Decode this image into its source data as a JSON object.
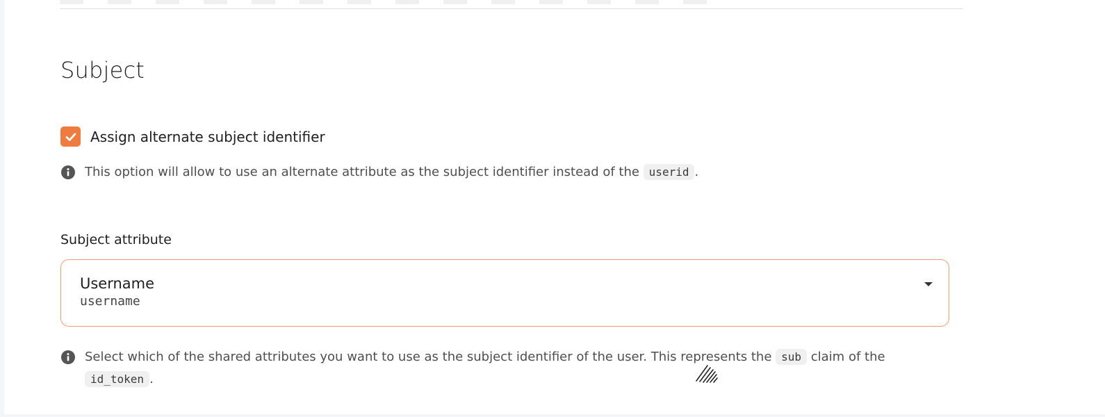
{
  "section": {
    "title": "Subject"
  },
  "alt_subject": {
    "checkbox_checked": true,
    "label": "Assign alternate subject identifier",
    "hint_prefix": "This option will allow to use an alternate attribute as the subject identifier instead of the ",
    "hint_code": "userid",
    "hint_suffix": "."
  },
  "subject_attribute": {
    "label": "Subject attribute",
    "selected_name": "Username",
    "selected_key": "username",
    "hint_prefix": "Select which of the shared attributes you want to use as the subject identifier of the user. This represents the ",
    "hint_code1": "sub",
    "hint_mid": " claim of the ",
    "hint_code2": "id_token",
    "hint_suffix": "."
  },
  "icons": {
    "info": "info-icon",
    "check": "check-icon",
    "caret": "caret-down-icon"
  },
  "colors": {
    "accent": "#f07b3f",
    "select_border": "#f0a070",
    "code_bg": "#f0f0f0"
  }
}
